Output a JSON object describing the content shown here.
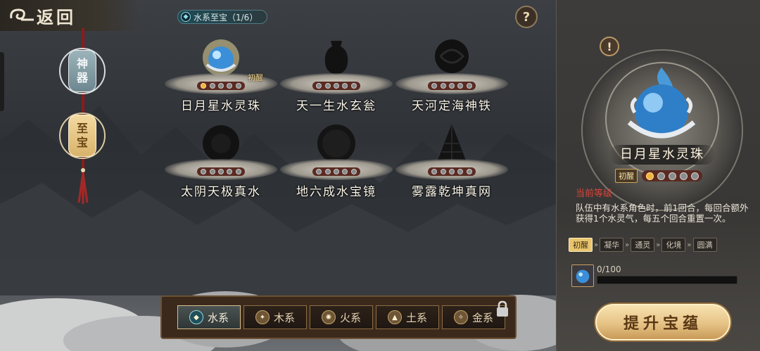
{
  "header": {
    "back_label": "返回"
  },
  "series_pill": {
    "label": "水系至宝（1/6）"
  },
  "help": {
    "label": "?"
  },
  "tabs": [
    {
      "label_top": "神",
      "label_bottom": "器"
    },
    {
      "label_top": "至",
      "label_bottom": "宝"
    }
  ],
  "treasures": [
    {
      "name": "日月星水灵珠",
      "badge": "初醒",
      "level": 1,
      "unlocked": true
    },
    {
      "name": "天一生水玄瓮",
      "badge": "",
      "level": 0,
      "unlocked": false
    },
    {
      "name": "天河定海神铁",
      "badge": "",
      "level": 0,
      "unlocked": false
    },
    {
      "name": "太阴天极真水",
      "badge": "",
      "level": 0,
      "unlocked": false
    },
    {
      "name": "地六成水宝镜",
      "badge": "",
      "level": 0,
      "unlocked": false
    },
    {
      "name": "雾露乾坤真网",
      "badge": "",
      "level": 0,
      "unlocked": false
    }
  ],
  "elements": [
    {
      "label": "水系",
      "active": true
    },
    {
      "label": "木系",
      "active": false
    },
    {
      "label": "火系",
      "active": false
    },
    {
      "label": "土系",
      "active": false
    },
    {
      "label": "金系",
      "active": false
    }
  ],
  "detail": {
    "warn": "!",
    "name": "日月星水灵珠",
    "level_tag": "初醒",
    "level": 1,
    "current_level_label": "当前等级",
    "description": "队伍中有水系角色时，前1回合，每回合额外获得1个水灵气，每五个回合重置一次。",
    "stages": [
      "初醒",
      "凝华",
      "通灵",
      "化境",
      "圆满"
    ],
    "exp_text": "0/100",
    "exp_progress": 0,
    "upgrade_label": "提升宝蕴"
  },
  "colors": {
    "accent_gold": "#e6c386",
    "active_red": "#d9453a",
    "water_blue": "#4a9ad8"
  }
}
